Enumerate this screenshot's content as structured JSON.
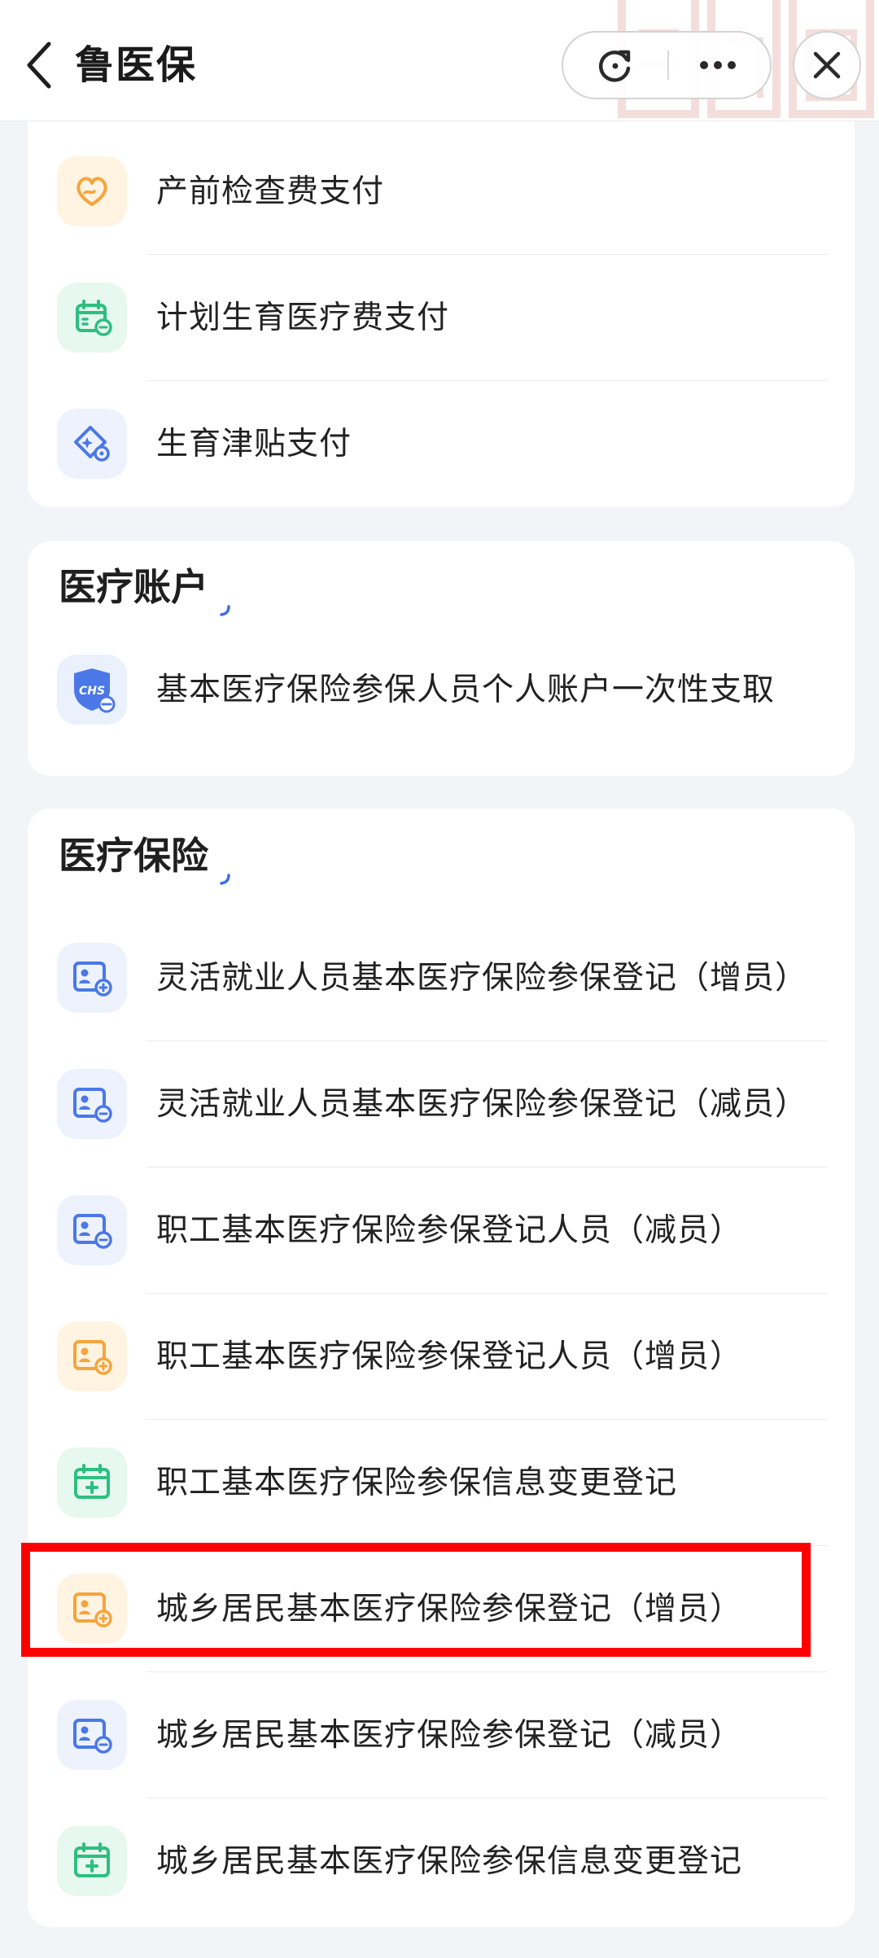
{
  "header": {
    "title": "鲁医保",
    "back_icon": "chevron-left-icon",
    "refresh_icon": "refresh-icon",
    "more_icon": "more-dots-icon",
    "close_icon": "close-icon"
  },
  "colors": {
    "orange": "#f4a53b",
    "green": "#2dbf7e",
    "blue": "#4b78e6",
    "highlight": "#ff0000",
    "title_mark": "#3b6fe8"
  },
  "sections": [
    {
      "title": "",
      "items": [
        {
          "label": "产前检查费支付",
          "icon": "heart-hands-icon",
          "color": "orange"
        },
        {
          "label": "计划生育医疗费支付",
          "icon": "calendar-heart-icon",
          "color": "green"
        },
        {
          "label": "生育津贴支付",
          "icon": "diamond-sparkle-icon",
          "color": "blue"
        }
      ]
    },
    {
      "title": "医疗账户",
      "items": [
        {
          "label": "基本医疗保险参保人员个人账户一次性支取",
          "icon": "shield-badge-icon",
          "color": "blue"
        }
      ]
    },
    {
      "title": "医疗保险",
      "items": [
        {
          "label": "灵活就业人员基本医疗保险参保登记（增员）",
          "icon": "id-card-plus-icon",
          "color": "blue"
        },
        {
          "label": "灵活就业人员基本医疗保险参保登记（减员）",
          "icon": "id-card-minus-icon",
          "color": "blue"
        },
        {
          "label": "职工基本医疗保险参保登记人员（减员）",
          "icon": "id-card-minus-icon",
          "color": "blue"
        },
        {
          "label": "职工基本医疗保险参保登记人员（增员）",
          "icon": "id-card-plus-icon",
          "color": "orange"
        },
        {
          "label": "职工基本医疗保险参保信息变更登记",
          "icon": "calendar-plus-icon",
          "color": "green"
        },
        {
          "label": "城乡居民基本医疗保险参保登记（增员）",
          "icon": "id-card-plus-icon",
          "color": "orange",
          "highlighted": true
        },
        {
          "label": "城乡居民基本医疗保险参保登记（减员）",
          "icon": "id-card-minus-icon",
          "color": "blue"
        },
        {
          "label": "城乡居民基本医疗保险参保信息变更登记",
          "icon": "calendar-plus-icon",
          "color": "green"
        }
      ]
    }
  ]
}
